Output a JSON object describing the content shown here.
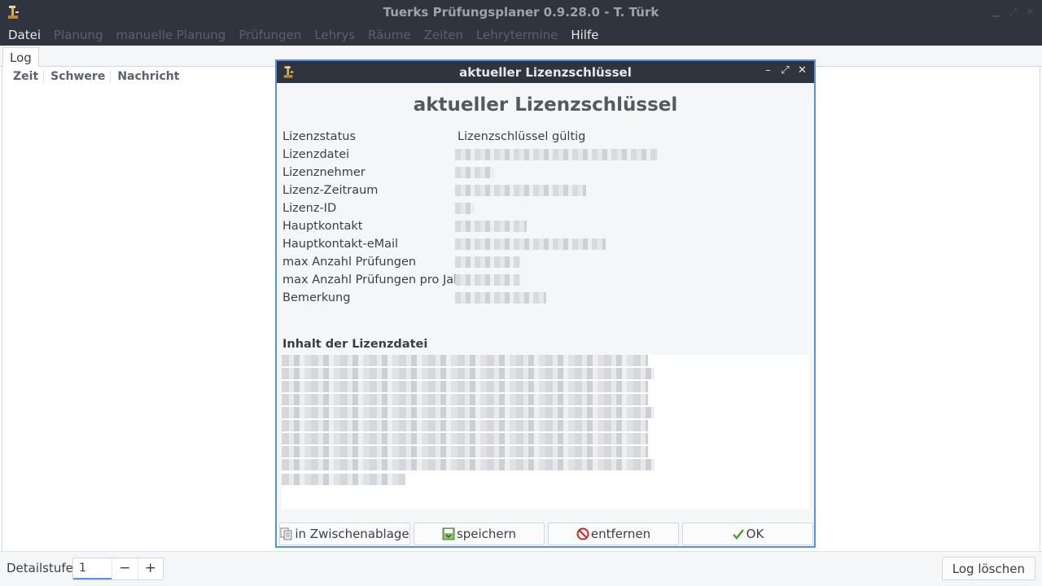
{
  "window": {
    "title": "Tuerks Prüfungsplaner 0.9.28.0 - T. Türk"
  },
  "menu": [
    {
      "label": "Datei",
      "enabled": true
    },
    {
      "label": "Planung",
      "enabled": false
    },
    {
      "label": "manuelle Planung",
      "enabled": false
    },
    {
      "label": "Prüfungen",
      "enabled": false
    },
    {
      "label": "Lehrys",
      "enabled": false
    },
    {
      "label": "Räume",
      "enabled": false
    },
    {
      "label": "Zeiten",
      "enabled": false
    },
    {
      "label": "Lehrytermine",
      "enabled": false
    },
    {
      "label": "Hilfe",
      "enabled": true
    }
  ],
  "log": {
    "tab_label": "Log",
    "columns": [
      "Zeit",
      "Schwere",
      "Nachricht"
    ]
  },
  "bottom": {
    "detail_label": "Detailstufe",
    "detail_value": "1",
    "minus": "−",
    "plus": "+",
    "clear_log": "Log löschen"
  },
  "dialog": {
    "title": "aktueller Lizenzschlüssel",
    "heading": "aktueller Lizenzschlüssel",
    "fields": [
      {
        "key": "Lizenzstatus",
        "value": "Lizenzschlüssel gültig"
      },
      {
        "key": "Lizenzdatei",
        "value": ""
      },
      {
        "key": "Lizenznehmer",
        "value": ""
      },
      {
        "key": "Lizenz-Zeitraum",
        "value": ""
      },
      {
        "key": "Lizenz-ID",
        "value": ""
      },
      {
        "key": "Hauptkontakt",
        "value": ""
      },
      {
        "key": "Hauptkontakt-eMail",
        "value": ""
      },
      {
        "key": "max Anzahl Prüfungen",
        "value": ""
      },
      {
        "key": "max Anzahl Prüfungen pro Jahr",
        "value": ""
      },
      {
        "key": "Bemerkung",
        "value": ""
      }
    ],
    "content_heading": "Inhalt der Lizenzdatei",
    "buttons": {
      "copy": "in Zwischenablage",
      "save": "speichern",
      "remove": "entfernen",
      "ok": "OK"
    }
  },
  "colors": {
    "titlebar_bg": "#2f343f",
    "accent": "#5294e2",
    "window_bg": "#f5f6f7"
  }
}
